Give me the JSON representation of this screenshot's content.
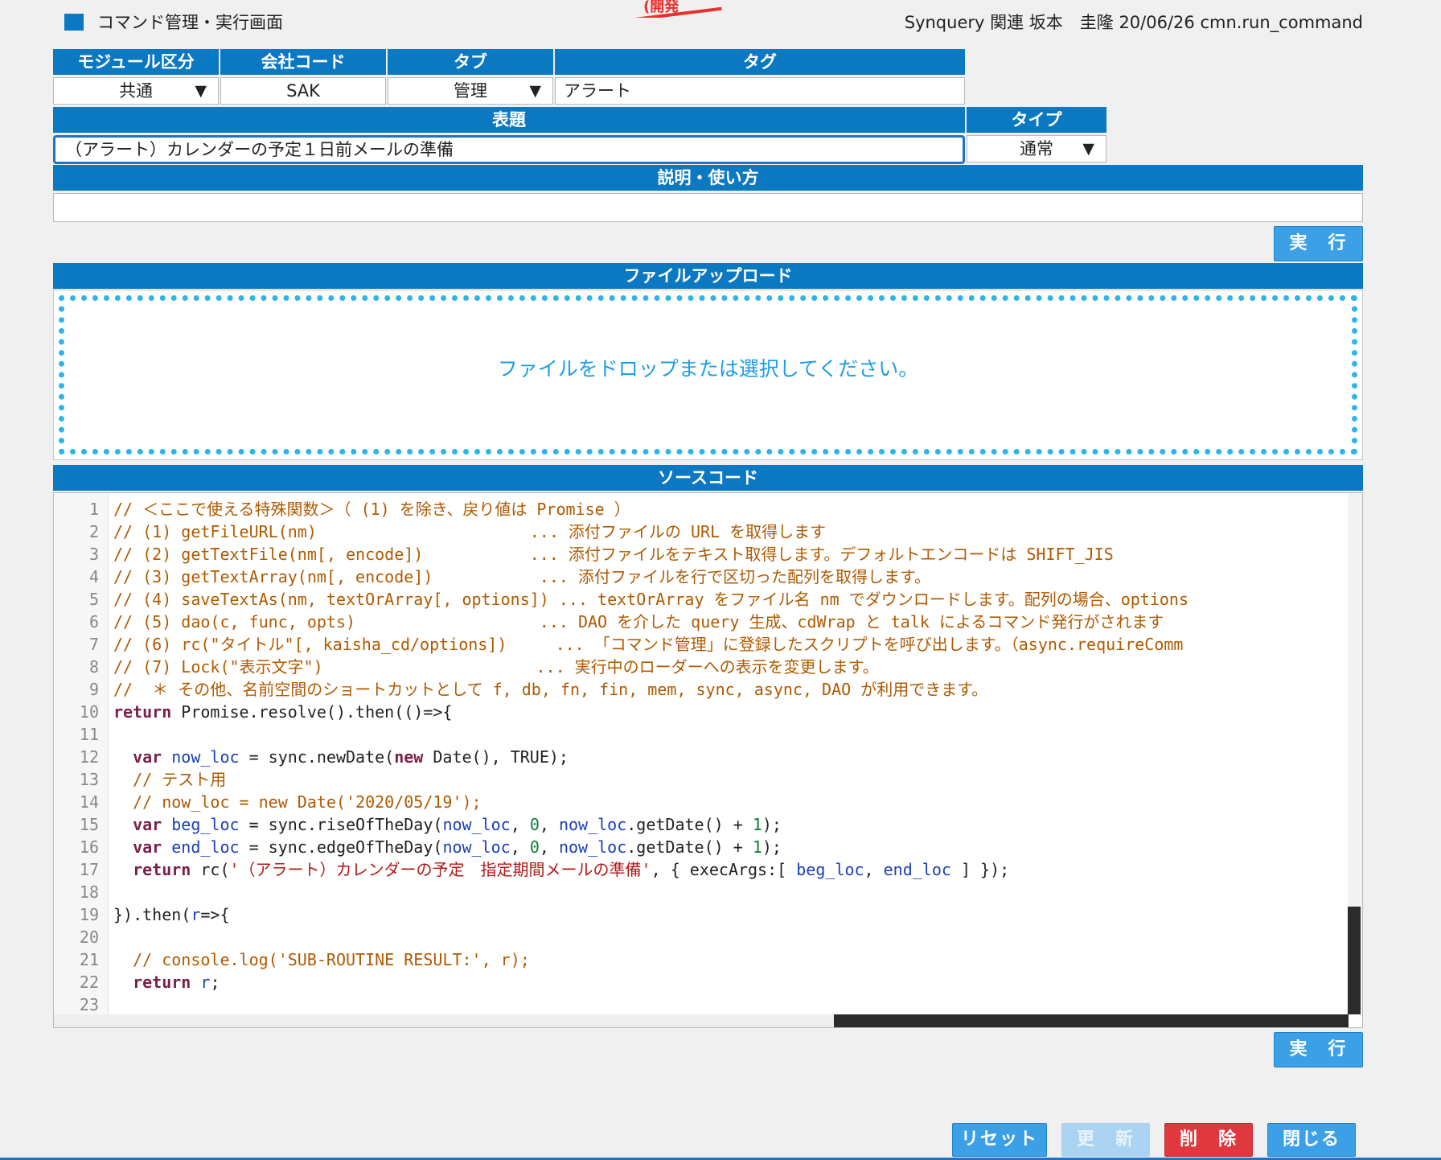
{
  "header": {
    "title": "コマンド管理・実行画面",
    "user_info": "Synquery 関連 坂本　圭隆 20/06/26 cmn.run_command",
    "stamp_text": "(開発"
  },
  "form": {
    "module": {
      "label": "モジュール区分",
      "value": "共通"
    },
    "company": {
      "label": "会社コード",
      "value": "SAK"
    },
    "tab": {
      "label": "タブ",
      "value": "管理"
    },
    "tag": {
      "label": "タグ",
      "value": "アラート"
    },
    "subject": {
      "label": "表題",
      "value": "（アラート）カレンダーの予定１日前メールの準備"
    },
    "type": {
      "label": "タイプ",
      "value": "通常"
    },
    "description": {
      "label": "説明・使い方",
      "value": ""
    }
  },
  "buttons": {
    "run": "実　行",
    "reset": "リセット",
    "update": "更　新",
    "delete": "削　除",
    "close": "閉じる"
  },
  "upload": {
    "label": "ファイルアップロード",
    "drop_text": "ファイルをドロップまたは選択してください。"
  },
  "source": {
    "label": "ソースコード",
    "line_numbers": [
      "1",
      "2",
      "3",
      "4",
      "5",
      "6",
      "7",
      "8",
      "9",
      "10",
      "11",
      "12",
      "13",
      "14",
      "15",
      "16",
      "17",
      "18",
      "19",
      "20",
      "21",
      "22",
      "23"
    ],
    "lines": [
      "// ＜ここで使える特殊関数＞（ (1) を除き、戻り値は Promise ）",
      "// (1) getFileURL(nm)                      ... 添付ファイルの URL を取得します",
      "// (2) getTextFile(nm[, encode])           ... 添付ファイルをテキスト取得します。デフォルトエンコードは SHIFT_JIS",
      "// (3) getTextArray(nm[, encode])           ... 添付ファイルを行で区切った配列を取得します。",
      "// (4) saveTextAs(nm, textOrArray[, options]) ... textOrArray をファイル名 nm でダウンロードします。配列の場合、options",
      "// (5) dao(c, func, opts)                   ... DAO を介した query 生成、cdWrap と talk によるコマンド発行がされます",
      "// (6) rc(\"タイトル\"[, kaisha_cd/options])     ... 「コマンド管理」に登録したスクリプトを呼び出します。（async.requireComm",
      "// (7) Lock(\"表示文字\")                      ... 実行中のローダーへの表示を変更します。",
      "//  ＊ その他、名前空間のショートカットとして f, db, fn, fin, mem, sync, async, DAO が利用できます。",
      "return Promise.resolve().then(()=>{",
      "",
      "  var now_loc = sync.newDate(new Date(), TRUE);",
      "  // テスト用",
      "  // now_loc = new Date('2020/05/19');",
      "  var beg_loc = sync.riseOfTheDay(now_loc, 0, now_loc.getDate() + 1);",
      "  var end_loc = sync.edgeOfTheDay(now_loc, 0, now_loc.getDate() + 1);",
      "  return rc('（アラート）カレンダーの予定　指定期間メールの準備', { execArgs:[ beg_loc, end_loc ] });",
      "",
      "}).then(r=>{",
      "",
      "  // console.log('SUB-ROUTINE RESULT:', r);",
      "  return r;",
      ""
    ]
  },
  "colors": {
    "header_blue": "#0b78c2",
    "button_blue": "#3ba0e6",
    "delete_red": "#e0383e",
    "drop_dots": "#2db5ea",
    "comment": "#b05a00"
  }
}
